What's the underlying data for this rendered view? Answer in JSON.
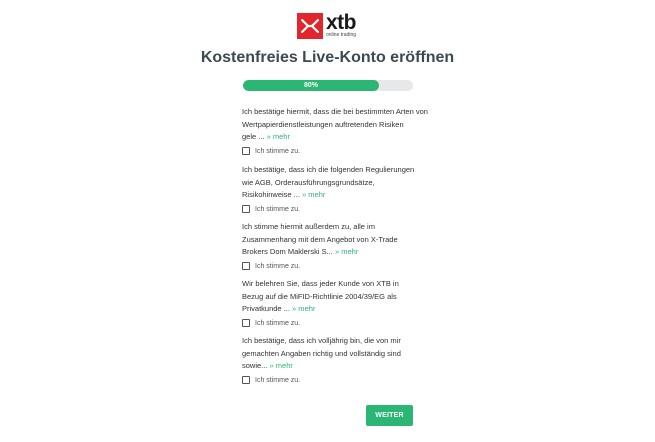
{
  "brand": {
    "name": "xtb",
    "tagline": "online trading",
    "color": "#e3262b",
    "icon": "xtb-x-logo-icon"
  },
  "title": "Kostenfreies Live-Konto eröffnen",
  "progress": {
    "percent": 80,
    "label": "80%",
    "color": "#2bb673"
  },
  "consents": [
    {
      "lines": [
        "Ich bestätige hiermit, dass die bei bestimmten Arten von",
        "Wertpapierdienstleistungen auftretenden Risiken",
        "gele ..."
      ],
      "more": "» mehr",
      "checkbox_label": "Ich stimme zu."
    },
    {
      "lines": [
        "Ich bestätige, dass ich die folgenden Regulierungen",
        "wie AGB, Orderausführungsgrundsätze,",
        "Risikohinweise ..."
      ],
      "more": "» mehr",
      "checkbox_label": "Ich stimme zu."
    },
    {
      "lines": [
        "Ich stimme hiermit außerdem zu, alle im",
        "Zusammenhang mit dem Angebot von X-Trade",
        "Brokers Dom Maklerski S..."
      ],
      "more": "» mehr",
      "checkbox_label": "Ich stimme zu."
    },
    {
      "lines": [
        "Wir belehren Sie, dass jeder Kunde von XTB in",
        "Bezug auf die MiFID-Richtlinie 2004/39/EG als",
        "Privatkunde ..."
      ],
      "more": "» mehr",
      "checkbox_label": "Ich stimme zu."
    },
    {
      "lines": [
        "Ich bestätige, dass ich volljährig bin, die von mir",
        "gemachten Angaben richtig und vollständig sind",
        "sowie..."
      ],
      "more": "» mehr",
      "checkbox_label": "Ich stimme zu."
    }
  ],
  "submit_label": "WEITER"
}
